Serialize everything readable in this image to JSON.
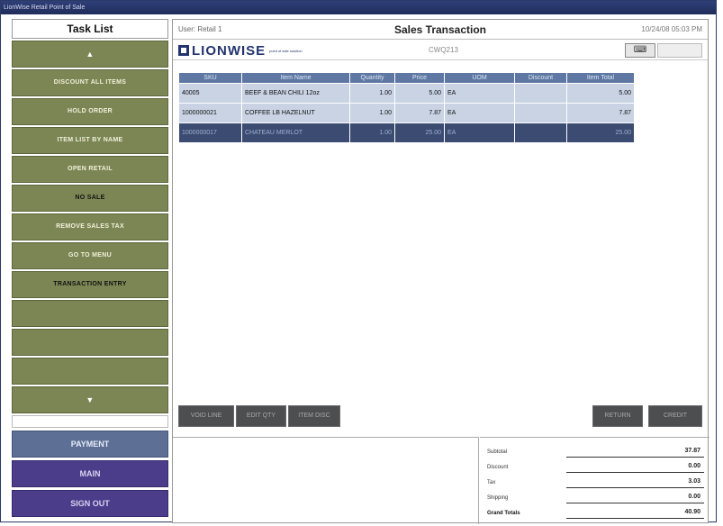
{
  "window": {
    "title": "LionWise Retail Point of Sale"
  },
  "tasks": {
    "header": "Task List",
    "scroll_up": "▲",
    "scroll_down": "▼",
    "items": [
      "DISCOUNT ALL ITEMS",
      "HOLD ORDER",
      "ITEM LIST BY NAME",
      "OPEN RETAIL",
      "NO SALE",
      "REMOVE SALES TAX",
      "GO TO MENU",
      "TRANSACTION ENTRY"
    ]
  },
  "nav": {
    "payment": "PAYMENT",
    "main": "MAIN",
    "sign_out": "SIGN OUT"
  },
  "header": {
    "user": "User: Retail 1",
    "title": "Sales Transaction",
    "datetime": "10/24/08 05:03 PM"
  },
  "brand": {
    "name": "LIONWISE",
    "tagline": "point of sale solution",
    "code": "CWQ213",
    "keyboard_icon": "keyboard-icon"
  },
  "table": {
    "columns": [
      "SKU",
      "Item Name",
      "Quantity",
      "Price",
      "UOM",
      "Discount",
      "Item Total"
    ],
    "rows": [
      [
        "40005",
        "BEEF & BEAN CHILI 12oz",
        "1.00",
        "5.00",
        "EA",
        "",
        "5.00"
      ],
      [
        "1000000021",
        "COFFEE LB HAZELNUT",
        "1.00",
        "7.87",
        "EA",
        "",
        "7.87"
      ],
      [
        "1000000017",
        "CHATEAU MERLOT",
        "1.00",
        "25.00",
        "EA",
        "",
        "25.00"
      ]
    ]
  },
  "actions": {
    "void_line": "VOID LINE",
    "edit_qty": "EDIT QTY",
    "item_disc": "ITEM DISC",
    "return": "RETURN",
    "credit": "CREDIT"
  },
  "totals": {
    "subtotal_label": "Subtotal",
    "subtotal": "37.87",
    "discount_label": "Discount",
    "discount": "0.00",
    "tax_label": "Tax",
    "tax": "3.03",
    "shipping_label": "Shipping",
    "shipping": "0.00",
    "grand_label": "Grand Totals",
    "grand": "40.90"
  },
  "colors": {
    "task_green": "#7b8654",
    "nav_purple": "#4b3d8a",
    "table_header": "#5e78a3",
    "row_light": "#c9d3e4",
    "row_selected": "#3b4b72",
    "brand_navy": "#23346e"
  }
}
